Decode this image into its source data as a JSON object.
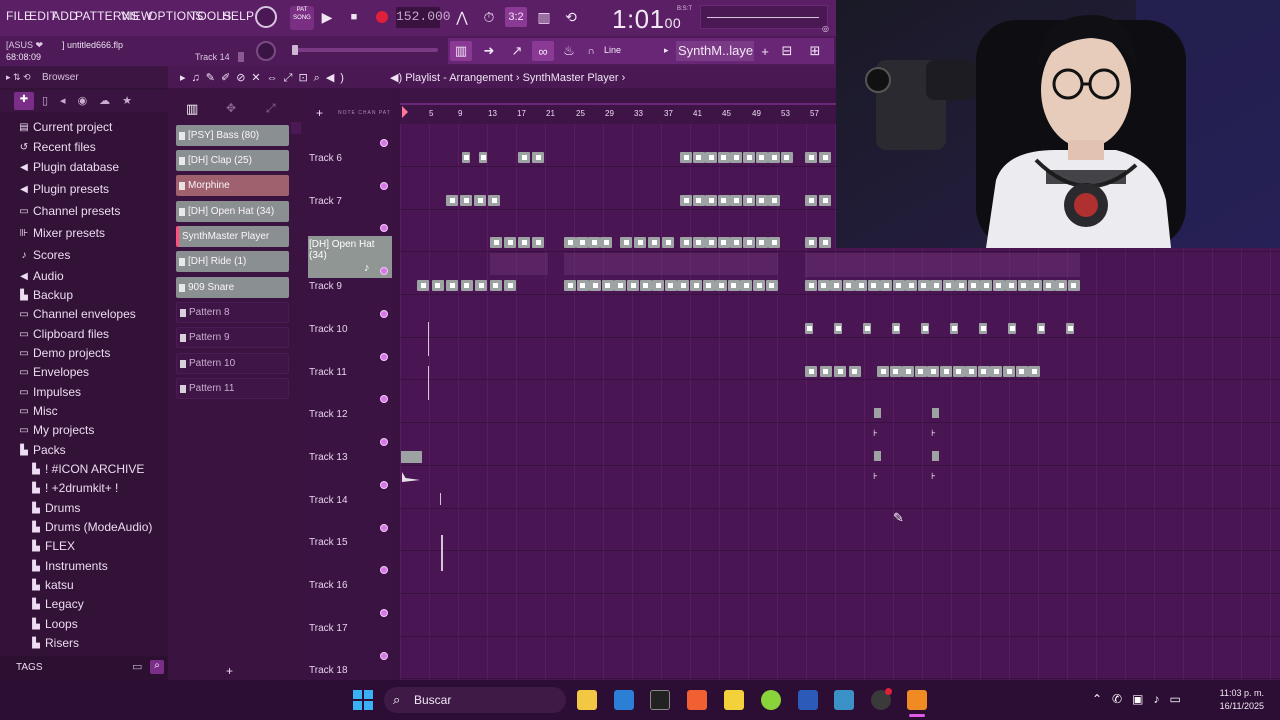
{
  "menu": [
    "FILE",
    "EDIT",
    "ADD",
    "PATTERNS",
    "VIEW",
    "OPTIONS",
    "TOOLS",
    "HELP"
  ],
  "transport": {
    "pat_song_label": "PAT SONG",
    "tempo": "152.000",
    "time_display": "1:01",
    "time_sub": "00",
    "time_unit": "B:S:T",
    "step_display": "3:2"
  },
  "hint": {
    "device": "[ASUS ❤",
    "file": "] untitled666.flp",
    "elapsed": "68:08:09",
    "track": "Track 14"
  },
  "toolbar2": {
    "snap": "Line",
    "instrument": "SynthM..layer"
  },
  "browser": {
    "title": "Browser",
    "items": [
      {
        "label": "Current project",
        "icon": "project-icon"
      },
      {
        "label": "Recent files",
        "icon": "recent-icon"
      },
      {
        "label": "Plugin database",
        "icon": "plugin-icon"
      },
      {
        "label": "Plugin presets",
        "icon": "plugin-icon"
      },
      {
        "label": "Channel presets",
        "icon": "channel-icon"
      },
      {
        "label": "Mixer presets",
        "icon": "mixer-icon"
      },
      {
        "label": "Scores",
        "icon": "note-icon"
      },
      {
        "label": "Audio",
        "icon": "speaker-icon"
      },
      {
        "label": "Backup",
        "icon": "backup-icon"
      },
      {
        "label": "Channel envelopes",
        "icon": "folder-icon"
      },
      {
        "label": "Clipboard files",
        "icon": "folder-icon"
      },
      {
        "label": "Demo projects",
        "icon": "folder-icon"
      },
      {
        "label": "Envelopes",
        "icon": "folder-icon"
      },
      {
        "label": "Impulses",
        "icon": "folder-icon"
      },
      {
        "label": "Misc",
        "icon": "folder-icon"
      },
      {
        "label": "My projects",
        "icon": "folder-icon"
      },
      {
        "label": "Packs",
        "icon": "folder-icon"
      }
    ],
    "subitems": [
      "! #ICON ARCHIVE",
      "! +2drumkit+ !",
      "Drums",
      "Drums (ModeAudio)",
      "FLEX",
      "Instruments",
      "katsu",
      "Legacy",
      "Loops",
      "Risers"
    ],
    "tags_label": "TAGS"
  },
  "playlist": {
    "title": "Playlist - Arrangement",
    "sep": "›",
    "instrument": "SynthMaster Player"
  },
  "patterns": [
    {
      "label": "[PSY] Bass (80)",
      "style": "full"
    },
    {
      "label": "[DH] Clap (25)",
      "style": "full"
    },
    {
      "label": "Morphine",
      "style": "light"
    },
    {
      "label": "[DH] Open Hat (34)",
      "style": "full"
    },
    {
      "label": "SynthMaster Player",
      "style": "sel"
    },
    {
      "label": "[DH] Ride (1)",
      "style": "full"
    },
    {
      "label": "909 Snare",
      "style": "full"
    },
    {
      "label": "Pattern 8",
      "style": "empty"
    },
    {
      "label": "Pattern 9",
      "style": "empty"
    },
    {
      "label": "Pattern 10",
      "style": "empty"
    },
    {
      "label": "Pattern 11",
      "style": "empty"
    }
  ],
  "tracks": [
    "Track 6",
    "Track 7",
    "[DH] Open Hat (34)",
    "Track 9",
    "Track 10",
    "Track 11",
    "Track 12",
    "Track 13",
    "Track 14",
    "Track 15",
    "Track 16",
    "Track 17",
    "Track 18"
  ],
  "ruler": [
    "5",
    "9",
    "13",
    "17",
    "21",
    "25",
    "29",
    "33",
    "37",
    "41",
    "45",
    "49",
    "53",
    "57"
  ],
  "taskbar": {
    "search": "Buscar",
    "time": "11:03 p. m.",
    "date": "16/11/2025"
  },
  "colors": {
    "accent": "#5b1f66",
    "clip": "#9da3a3",
    "record": "#e0203a"
  }
}
